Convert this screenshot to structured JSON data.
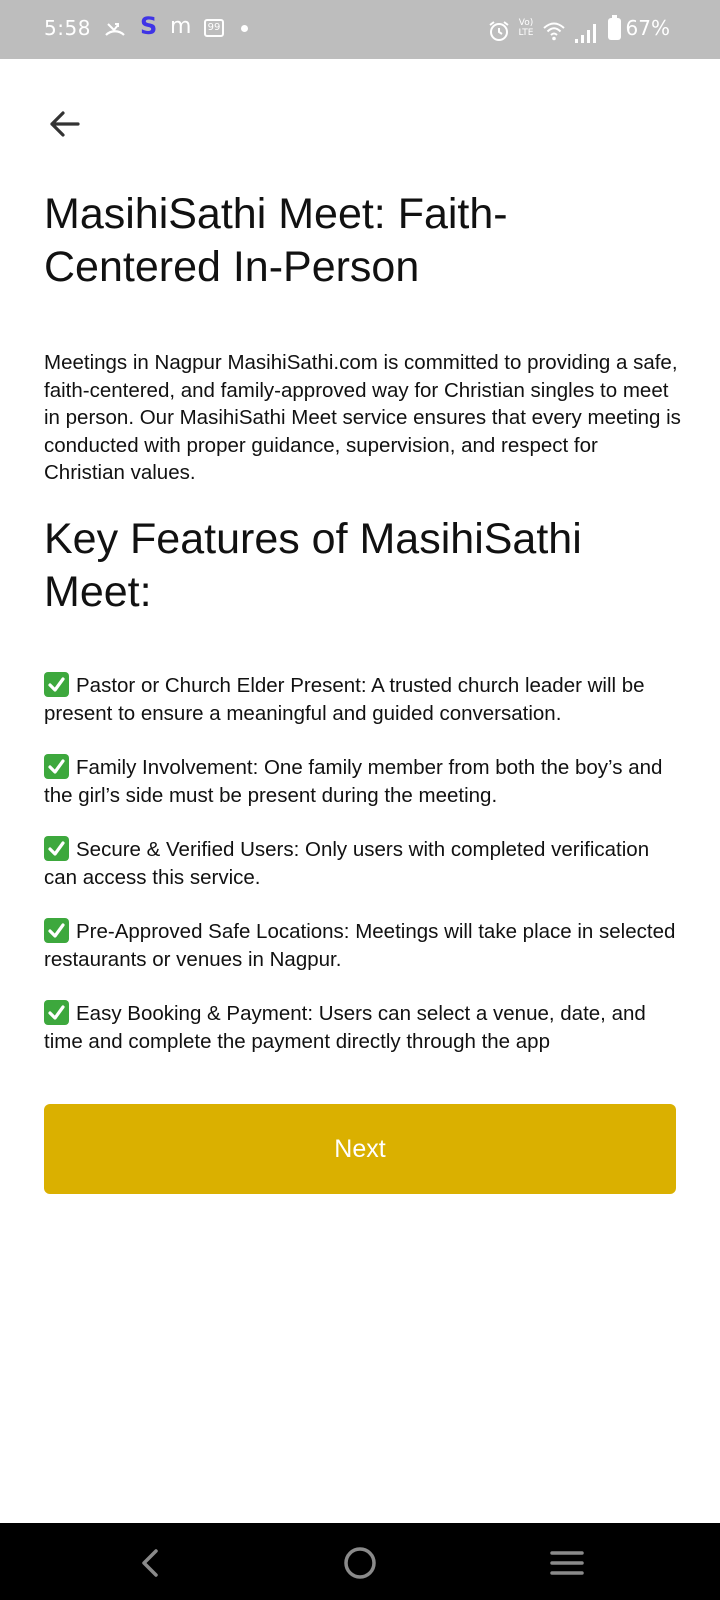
{
  "status_bar": {
    "time": "5:58",
    "icons": [
      "missed-call-icon",
      "s-app-icon",
      "m-app-icon",
      "99-app-icon",
      "dot-icon",
      "alarm-icon",
      "volte-icon",
      "wifi-icon",
      "signal-icon",
      "battery-icon"
    ],
    "app_s": "S",
    "app_m": "m",
    "app_99": "99",
    "volte": "Vo) LTE",
    "battery_percent": "67%"
  },
  "header": {
    "back_icon": "arrow-left-icon"
  },
  "page": {
    "title": "MasihiSathi Meet: Faith-Centered In-Person",
    "intro": "Meetings in Nagpur MasihiSathi.com is committed to providing a safe, faith-centered, and family-approved way for Christian singles to meet in person. Our MasihiSathi Meet service ensures that every meeting is conducted with proper guidance, supervision, and respect for Christian values.",
    "features_title": "Key Features of MasihiSathi Meet:",
    "features": [
      "Pastor or Church Elder Present: A trusted church leader will be present to ensure a meaningful and guided conversation.",
      "Family Involvement: One family member from both the boy’s and the girl’s side must be present during the meeting.",
      "Secure & Verified Users: Only users with completed verification can access this service.",
      "Pre-Approved Safe Locations: Meetings will take place in selected restaurants or venues in Nagpur.",
      "Easy Booking & Payment: Users can select a venue, date, and time and complete the payment directly through the app"
    ],
    "check_color": "#3da83d",
    "next_label": "Next",
    "accent_color": "#dab000"
  },
  "nav_bar": {
    "icons": [
      "nav-back-icon",
      "nav-home-icon",
      "nav-recents-icon"
    ]
  }
}
